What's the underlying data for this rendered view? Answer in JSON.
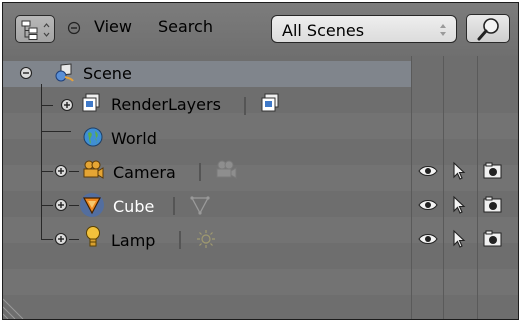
{
  "header": {
    "editor_type_icon": "outliner-editor-icon",
    "collapse_icon": "collapse-circle-icon",
    "menus": [
      "View",
      "Search"
    ],
    "scene_selector": {
      "value": "All Scenes",
      "icon": "up-down-arrows-icon"
    },
    "search_icon": "magnifier-icon"
  },
  "tree": {
    "scene": {
      "label": "Scene",
      "expand_icon": "collapse-toggle-icon",
      "icon": "scene-icon"
    },
    "items": [
      {
        "label": "RenderLayers",
        "icon": "render-layers-icon",
        "child_icon": "render-layer-icon",
        "expand_icon": "expand-toggle-icon"
      },
      {
        "label": "World",
        "icon": "world-icon"
      },
      {
        "label": "Camera",
        "icon": "camera-object-icon",
        "child_icon": "camera-data-icon",
        "expand_icon": "expand-toggle-icon",
        "visible": true,
        "selectable": true,
        "renderable": true
      },
      {
        "label": "Cube",
        "icon": "mesh-object-icon",
        "child_icon": "mesh-data-icon",
        "expand_icon": "expand-toggle-icon",
        "selected": true,
        "visible": true,
        "selectable": true,
        "renderable": true
      },
      {
        "label": "Lamp",
        "icon": "lamp-object-icon",
        "child_icon": "lamp-data-icon",
        "expand_icon": "expand-toggle-icon",
        "visible": true,
        "selectable": true,
        "renderable": true
      }
    ],
    "restriction_icons": [
      "eye-icon",
      "cursor-arrow-icon",
      "camera-render-icon"
    ]
  },
  "colors": {
    "background": "#6e6e6e",
    "selected_row": "#80858c",
    "selected_text": "#ffffff"
  }
}
